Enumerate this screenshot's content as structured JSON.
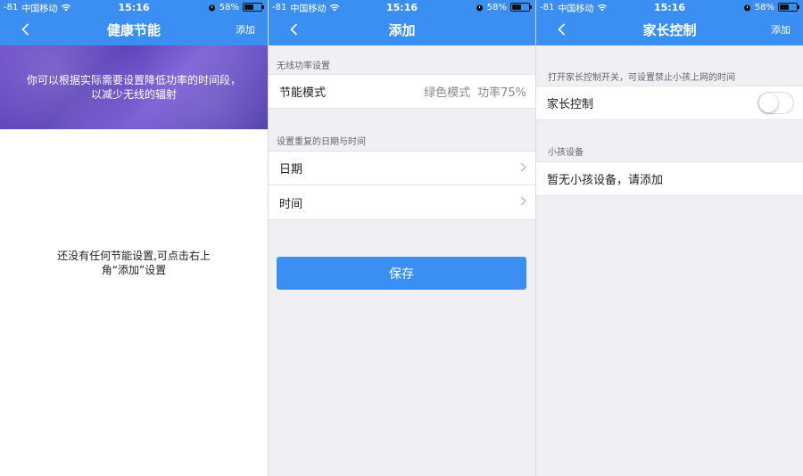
{
  "status": {
    "signal": "-81",
    "carrier": "中国移动",
    "time": "15:16",
    "battery": "58%",
    "battery_level": 0.58
  },
  "screen1": {
    "title": "健康节能",
    "right_action": "添加",
    "banner_text": "你可以根据实际需要设置降低功率的时间段，以减少无线的辐射",
    "empty_text": "还没有任何节能设置,可点击右上角“添加”设置"
  },
  "screen2": {
    "title": "添加",
    "section1_header": "无线功率设置",
    "mode_label": "节能模式",
    "mode_value": "绿色模式",
    "power_value": "功率75%",
    "section2_header": "设置重复的日期与时间",
    "date_label": "日期",
    "time_label": "时间",
    "save_label": "保存"
  },
  "screen3": {
    "title": "家长控制",
    "right_action": "添加",
    "section1_header": "打开家长控制开关，可设置禁止小孩上网的时间",
    "toggle_label": "家长控制",
    "toggle_on": false,
    "section2_header": "小孩设备",
    "empty_label": "暂无小孩设备，请添加"
  },
  "colors": {
    "primary": "#3b8ff3",
    "banner": "#5a3fb8",
    "grouped_bg": "#efeff4"
  }
}
